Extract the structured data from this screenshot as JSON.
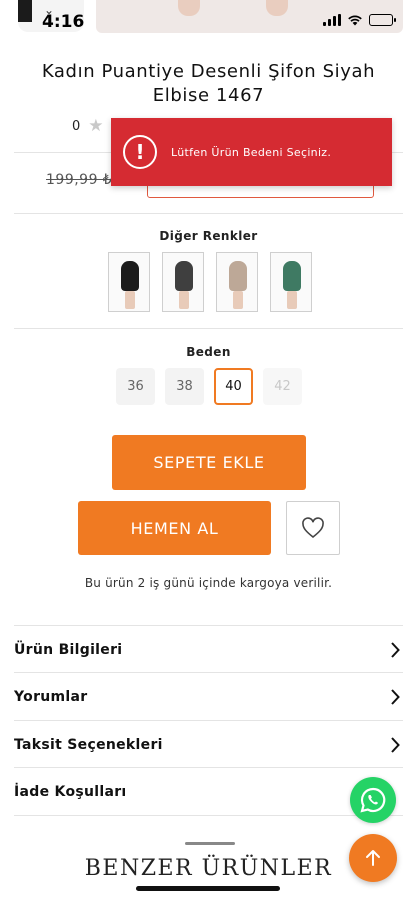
{
  "status_bar": {
    "time": "4:16"
  },
  "product": {
    "title": "Kadın Puantiye Desenli Şifon Siyah Elbise 1467",
    "rating_count": "0",
    "old_price": "199,99 ₺"
  },
  "toast": {
    "message": "Lütfen Ürün Bedeni Seçiniz."
  },
  "colors": {
    "label": "Diğer Renkler",
    "swatches": [
      {
        "name": "Siyah",
        "color": "#1c1c1c"
      },
      {
        "name": "Füme",
        "color": "#3f3f3f"
      },
      {
        "name": "Bej",
        "color": "#bda897"
      },
      {
        "name": "Yeşil",
        "color": "#3f7a63"
      }
    ]
  },
  "sizes": {
    "label": "Beden",
    "options": [
      "36",
      "38",
      "40",
      "42"
    ],
    "selected": "40",
    "disabled": [
      "42"
    ]
  },
  "actions": {
    "add_to_cart": "SEPETE EKLE",
    "buy_now": "HEMEN AL"
  },
  "shipping_note": "Bu ürün 2 iş günü içinde kargoya verilir.",
  "accordion": [
    {
      "label": "Ürün Bilgileri"
    },
    {
      "label": "Yorumlar"
    },
    {
      "label": "Taksit Seçenekleri"
    },
    {
      "label": "İade Koşulları"
    }
  ],
  "related": {
    "title": "BENZER ÜRÜNLER"
  },
  "theme": {
    "accent": "#f07a22",
    "error": "#d52b32",
    "whatsapp": "#25d366"
  },
  "icons": [
    "chevron-down-icon",
    "wifi-icon",
    "battery-icon",
    "star-icon",
    "alert-icon",
    "heart-icon",
    "chevron-right-icon",
    "whatsapp-icon",
    "arrow-up-icon"
  ]
}
